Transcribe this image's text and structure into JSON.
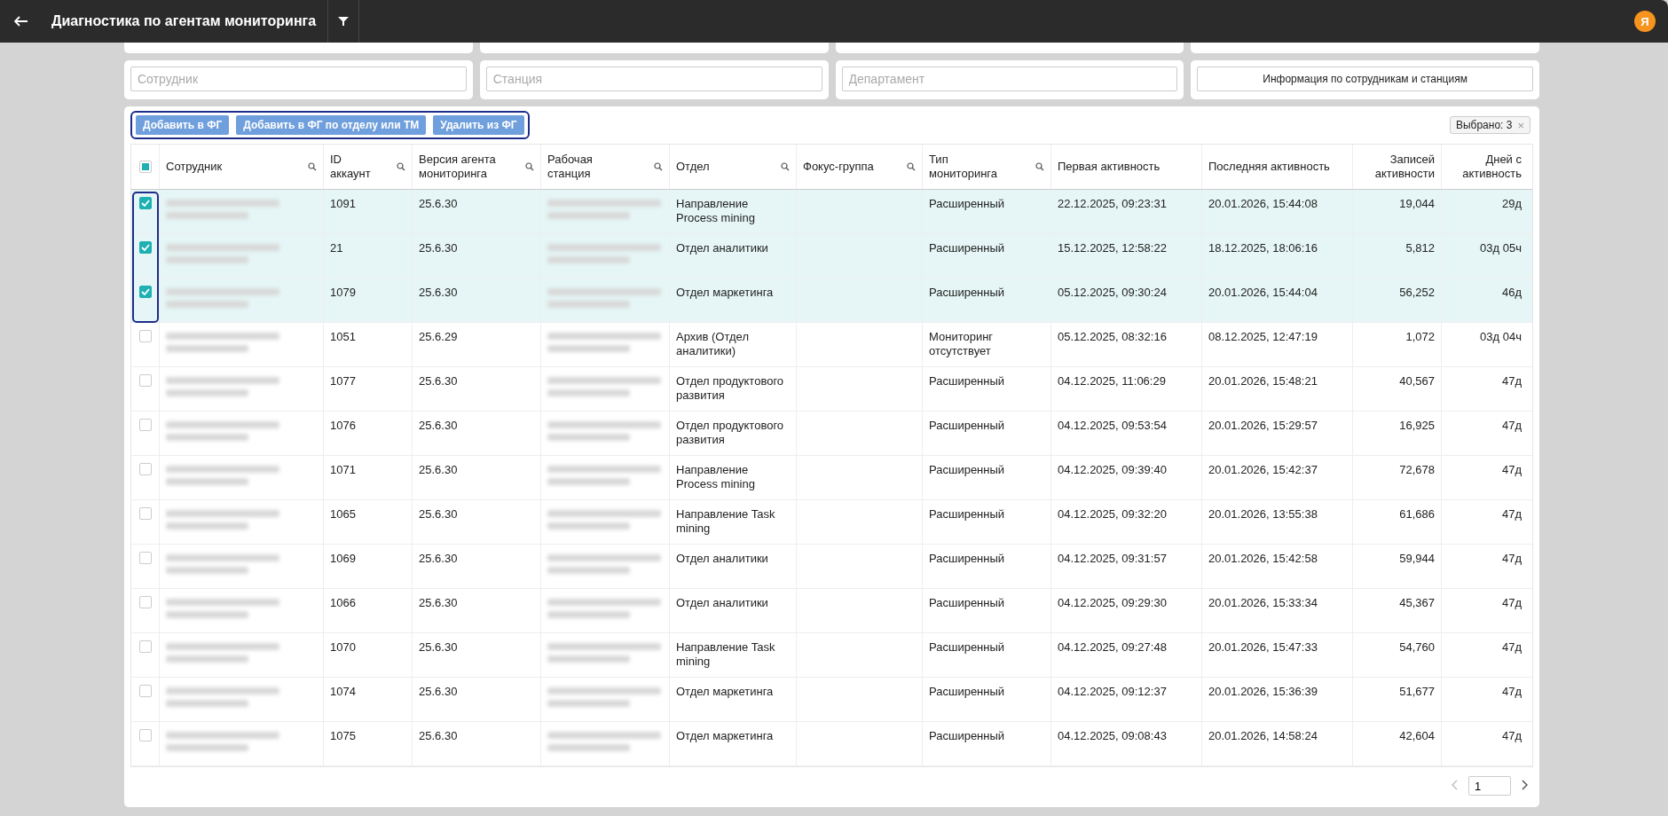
{
  "topbar": {
    "title": "Диагностика по агентам мониторинга",
    "avatar": "Я"
  },
  "filters": {
    "fields": [
      {
        "placeholder": "Сотрудник"
      },
      {
        "placeholder": "Станция"
      },
      {
        "placeholder": "Департамент"
      }
    ],
    "info_button": "Информация по сотрудникам и станциям"
  },
  "toolbar": {
    "outlined": true,
    "buttons": [
      "Добавить в ФГ",
      "Добавить в ФГ по отделу или ТМ",
      "Удалить из ФГ"
    ],
    "selected_chip": "Выбрано: 3",
    "chip_close": "×"
  },
  "table": {
    "select_all_partial": true,
    "checkboxes_outlined": true,
    "columns": [
      {
        "label": "Сотрудник",
        "kind": "blurred",
        "search": true
      },
      {
        "label": "ID аккаунт",
        "kind": "text",
        "search": true
      },
      {
        "label": "Версия агента мониторинга",
        "kind": "text",
        "search": true
      },
      {
        "label": "Рабочая станция",
        "kind": "blurred",
        "search": true
      },
      {
        "label": "Отдел",
        "kind": "text",
        "search": true
      },
      {
        "label": "Фокус-группа",
        "kind": "empty",
        "search": true
      },
      {
        "label": "Тип мониторинга",
        "kind": "text",
        "search": true
      },
      {
        "label": "Первая активность",
        "kind": "text",
        "search": false
      },
      {
        "label": "Последняя активность",
        "kind": "text",
        "search": false
      },
      {
        "label": "Записей активности",
        "kind": "number",
        "search": false
      },
      {
        "label": "Дней с активность",
        "kind": "number",
        "search": false
      }
    ],
    "rows": [
      {
        "selected": true,
        "cells": [
          "",
          "1091",
          "25.6.30",
          "",
          "Направление Process mining",
          "",
          "Расширенный",
          "22.12.2025, 09:23:31",
          "20.01.2026, 15:44:08",
          "19,044",
          "29д"
        ]
      },
      {
        "selected": true,
        "cells": [
          "",
          "21",
          "25.6.30",
          "",
          "Отдел аналитики",
          "",
          "Расширенный",
          "15.12.2025, 12:58:22",
          "18.12.2025, 18:06:16",
          "5,812",
          "03д 05ч"
        ]
      },
      {
        "selected": true,
        "cells": [
          "",
          "1079",
          "25.6.30",
          "",
          "Отдел маркетинга",
          "",
          "Расширенный",
          "05.12.2025, 09:30:24",
          "20.01.2026, 15:44:04",
          "56,252",
          "46д"
        ]
      },
      {
        "selected": false,
        "cells": [
          "",
          "1051",
          "25.6.29",
          "",
          "Архив (Отдел аналитики)",
          "",
          "Мониторинг отсутствует",
          "05.12.2025, 08:32:16",
          "08.12.2025, 12:47:19",
          "1,072",
          "03д 04ч"
        ]
      },
      {
        "selected": false,
        "cells": [
          "",
          "1077",
          "25.6.30",
          "",
          "Отдел продуктового развития",
          "",
          "Расширенный",
          "04.12.2025, 11:06:29",
          "20.01.2026, 15:48:21",
          "40,567",
          "47д"
        ]
      },
      {
        "selected": false,
        "cells": [
          "",
          "1076",
          "25.6.30",
          "",
          "Отдел продуктового развития",
          "",
          "Расширенный",
          "04.12.2025, 09:53:54",
          "20.01.2026, 15:29:57",
          "16,925",
          "47д"
        ]
      },
      {
        "selected": false,
        "cells": [
          "",
          "1071",
          "25.6.30",
          "",
          "Направление Process mining",
          "",
          "Расширенный",
          "04.12.2025, 09:39:40",
          "20.01.2026, 15:42:37",
          "72,678",
          "47д"
        ]
      },
      {
        "selected": false,
        "cells": [
          "",
          "1065",
          "25.6.30",
          "",
          "Направление Task mining",
          "",
          "Расширенный",
          "04.12.2025, 09:32:20",
          "20.01.2026, 13:55:38",
          "61,686",
          "47д"
        ]
      },
      {
        "selected": false,
        "cells": [
          "",
          "1069",
          "25.6.30",
          "",
          "Отдел аналитики",
          "",
          "Расширенный",
          "04.12.2025, 09:31:57",
          "20.01.2026, 15:42:58",
          "59,944",
          "47д"
        ]
      },
      {
        "selected": false,
        "cells": [
          "",
          "1066",
          "25.6.30",
          "",
          "Отдел аналитики",
          "",
          "Расширенный",
          "04.12.2025, 09:29:30",
          "20.01.2026, 15:33:34",
          "45,367",
          "47д"
        ]
      },
      {
        "selected": false,
        "cells": [
          "",
          "1070",
          "25.6.30",
          "",
          "Направление Task mining",
          "",
          "Расширенный",
          "04.12.2025, 09:27:48",
          "20.01.2026, 15:47:33",
          "54,760",
          "47д"
        ]
      },
      {
        "selected": false,
        "cells": [
          "",
          "1074",
          "25.6.30",
          "",
          "Отдел маркетинга",
          "",
          "Расширенный",
          "04.12.2025, 09:12:37",
          "20.01.2026, 15:36:39",
          "51,677",
          "47д"
        ]
      },
      {
        "selected": false,
        "cells": [
          "",
          "1075",
          "25.6.30",
          "",
          "Отдел маркетинга",
          "",
          "Расширенный",
          "04.12.2025, 09:08:43",
          "20.01.2026, 14:58:24",
          "42,604",
          "47д"
        ]
      }
    ]
  },
  "pager": {
    "page": "1"
  }
}
